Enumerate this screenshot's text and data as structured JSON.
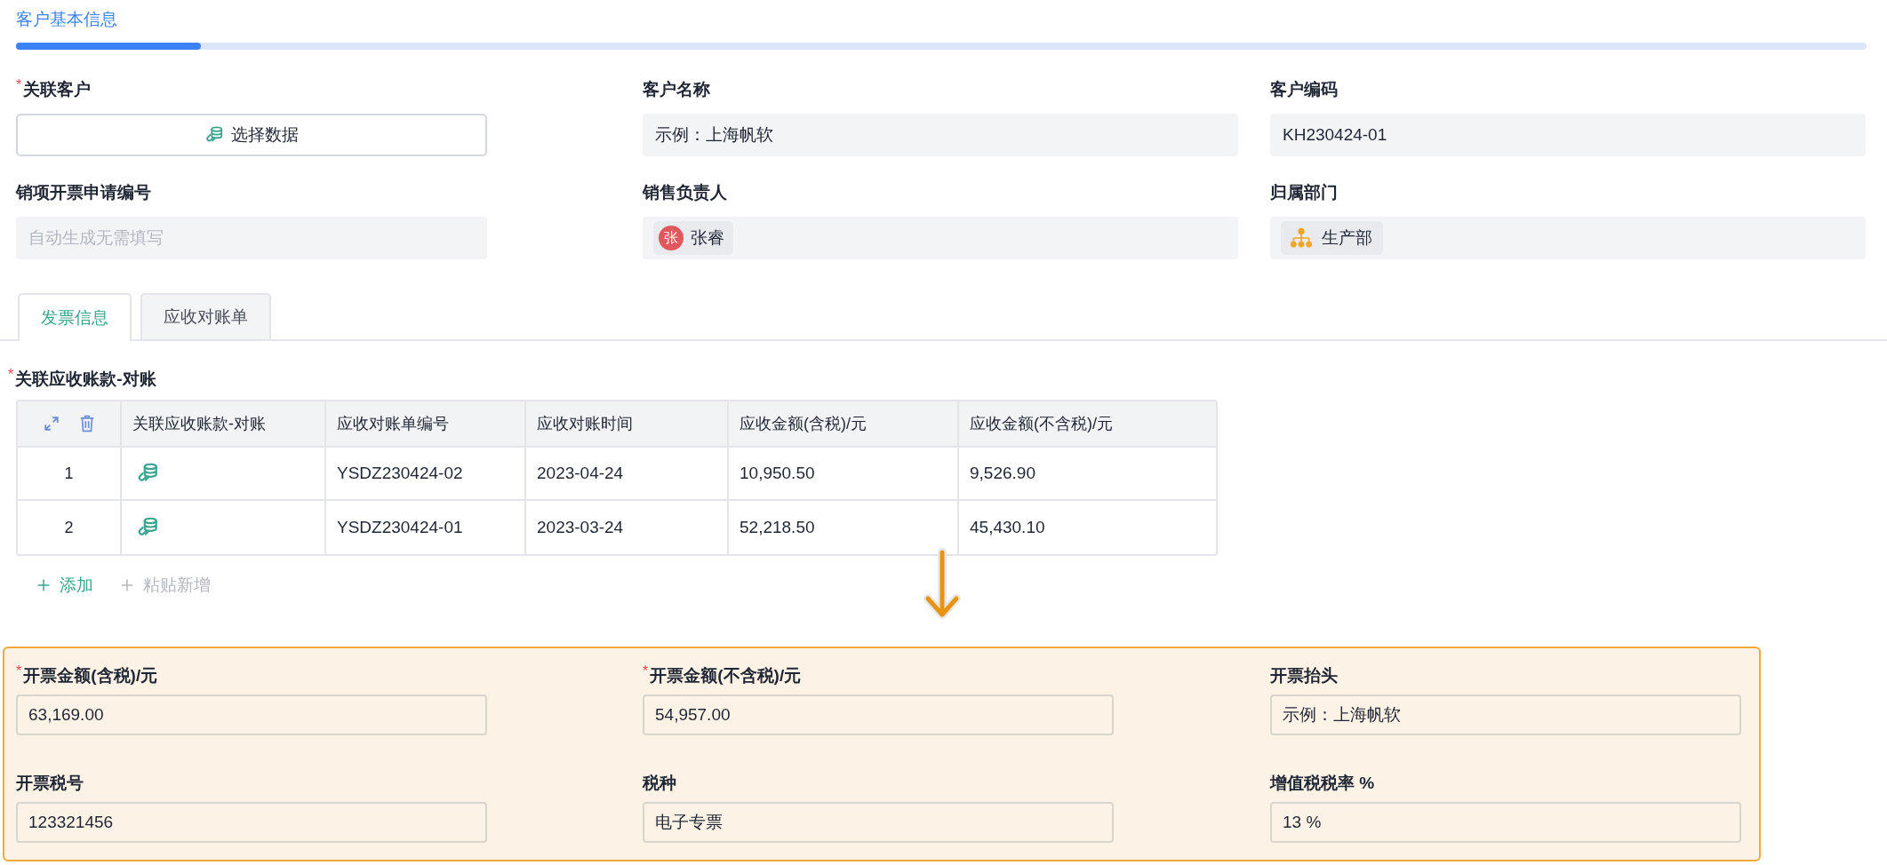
{
  "section_tab": {
    "label": "客户基本信息",
    "level": 0.1
  },
  "basic_fields": [
    {
      "label": "关联客户",
      "required_mark": "*",
      "kind": "picker",
      "value": "选择数据"
    },
    {
      "label": "客户名称",
      "kind": "readonly",
      "value": "示例：上海帆软"
    },
    {
      "label": "客户编码",
      "kind": "readonly",
      "value": "KH230424-01"
    },
    {
      "label": "销项开票申请编号",
      "kind": "placeholder",
      "placeholder": "自动生成无需填写"
    },
    {
      "label": "销售负责人",
      "kind": "person",
      "avatar": "张",
      "value": "张睿"
    },
    {
      "label": "归属部门",
      "kind": "department",
      "value": "生产部"
    }
  ],
  "tabs": [
    {
      "label": "发票信息",
      "selected": true
    },
    {
      "label": "应收对账单",
      "selected": false
    }
  ],
  "subtable": {
    "label": "关联应收账款-对账",
    "required_mark": "*",
    "columns": [
      "关联应收账款-对账",
      "应收对账单编号",
      "应收对账时间",
      "应收金额(含税)/元",
      "应收金额(不含税)/元"
    ],
    "rows": [
      {
        "index": "1",
        "cells": [
          "",
          "YSDZ230424-02",
          "2023-04-24",
          "10,950.50",
          "9,526.90"
        ]
      },
      {
        "index": "2",
        "cells": [
          "",
          "YSDZ230424-01",
          "2023-03-24",
          "52,218.50",
          "45,430.10"
        ]
      }
    ],
    "actions": [
      {
        "label": "添加",
        "disabled": false
      },
      {
        "label": "粘贴新增",
        "disabled": true
      }
    ]
  },
  "invoice_fields": [
    {
      "label": "开票金额(含税)/元",
      "required_mark": "*",
      "value": "63,169.00"
    },
    {
      "label": "开票金额(不含税)/元",
      "required_mark": "*",
      "value": "54,957.00"
    },
    {
      "label": "开票抬头",
      "value": "示例：上海帆软"
    },
    {
      "label": "开票税号",
      "value": "123321456"
    },
    {
      "label": "税种",
      "value": "电子专票"
    },
    {
      "label": "增值税税率 %",
      "value": "13 %"
    }
  ]
}
